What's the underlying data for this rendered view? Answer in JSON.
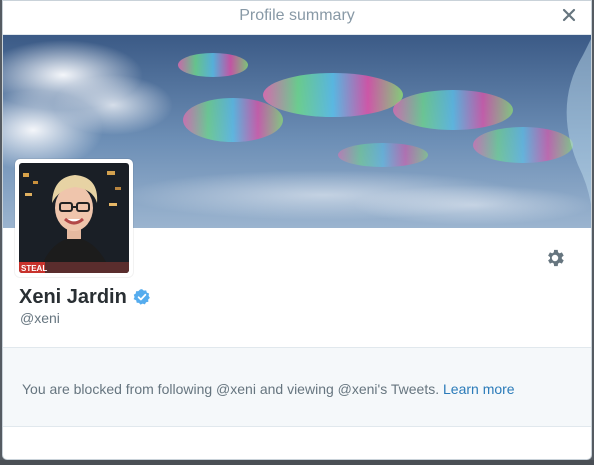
{
  "modal": {
    "title": "Profile summary"
  },
  "profile": {
    "name": "Xeni Jardin",
    "handle": "@xeni",
    "verified": true,
    "avatar_caption": "STEAL"
  },
  "blocked_notice": {
    "message": "You are blocked from following @xeni and viewing @xeni's Tweets.",
    "link_label": "Learn more"
  },
  "icons": {
    "close": "close-icon",
    "settings": "gear-icon",
    "verified": "verified-badge-icon"
  },
  "colors": {
    "verified_blue": "#55acee",
    "link": "#2b7bb9",
    "muted_text": "#66757f",
    "name_text": "#292f33"
  }
}
